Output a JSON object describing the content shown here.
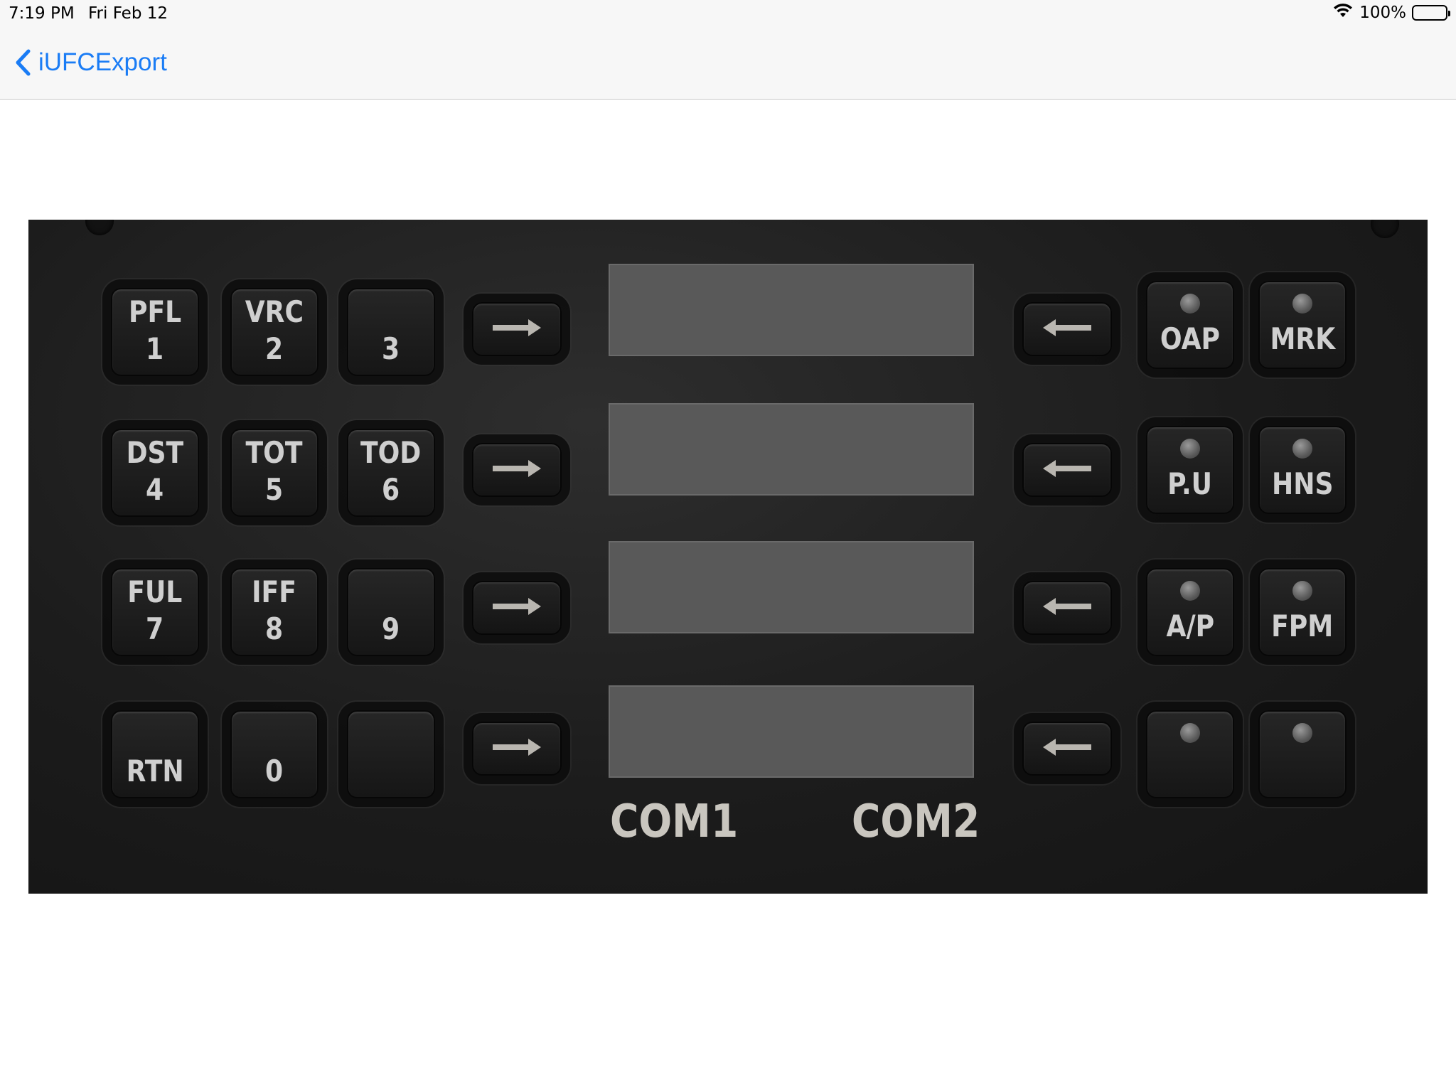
{
  "status_bar": {
    "time": "7:19 PM",
    "date": "Fri Feb 12",
    "battery": "100%"
  },
  "nav": {
    "back_label": "iUFCExport"
  },
  "panel": {
    "keypad": [
      {
        "id": "pfl-1",
        "lines": [
          "PFL",
          "1"
        ]
      },
      {
        "id": "vrc-2",
        "lines": [
          "VRC",
          "2"
        ]
      },
      {
        "id": "3",
        "lines": [
          "3"
        ]
      },
      {
        "id": "dst-4",
        "lines": [
          "DST",
          "4"
        ]
      },
      {
        "id": "tot-5",
        "lines": [
          "TOT",
          "5"
        ]
      },
      {
        "id": "tod-6",
        "lines": [
          "TOD",
          "6"
        ]
      },
      {
        "id": "ful-7",
        "lines": [
          "FUL",
          "7"
        ]
      },
      {
        "id": "iff-8",
        "lines": [
          "IFF",
          "8"
        ]
      },
      {
        "id": "9",
        "lines": [
          "9"
        ]
      },
      {
        "id": "rtn",
        "lines": [
          "RTN"
        ]
      },
      {
        "id": "0",
        "lines": [
          "0"
        ]
      },
      {
        "id": "blank",
        "lines": []
      }
    ],
    "annunciator_keys": [
      {
        "id": "oap",
        "label": "OAP"
      },
      {
        "id": "mrk",
        "label": "MRK"
      },
      {
        "id": "pu",
        "label": "P.U"
      },
      {
        "id": "hns",
        "label": "HNS"
      },
      {
        "id": "ap",
        "label": "A/P"
      },
      {
        "id": "fpm",
        "label": "FPM"
      },
      {
        "id": "blank-left",
        "label": ""
      },
      {
        "id": "blank-right",
        "label": ""
      }
    ],
    "displays": [
      "",
      "",
      "",
      ""
    ],
    "com_labels": {
      "com1": "COM1",
      "com2": "COM2"
    }
  }
}
